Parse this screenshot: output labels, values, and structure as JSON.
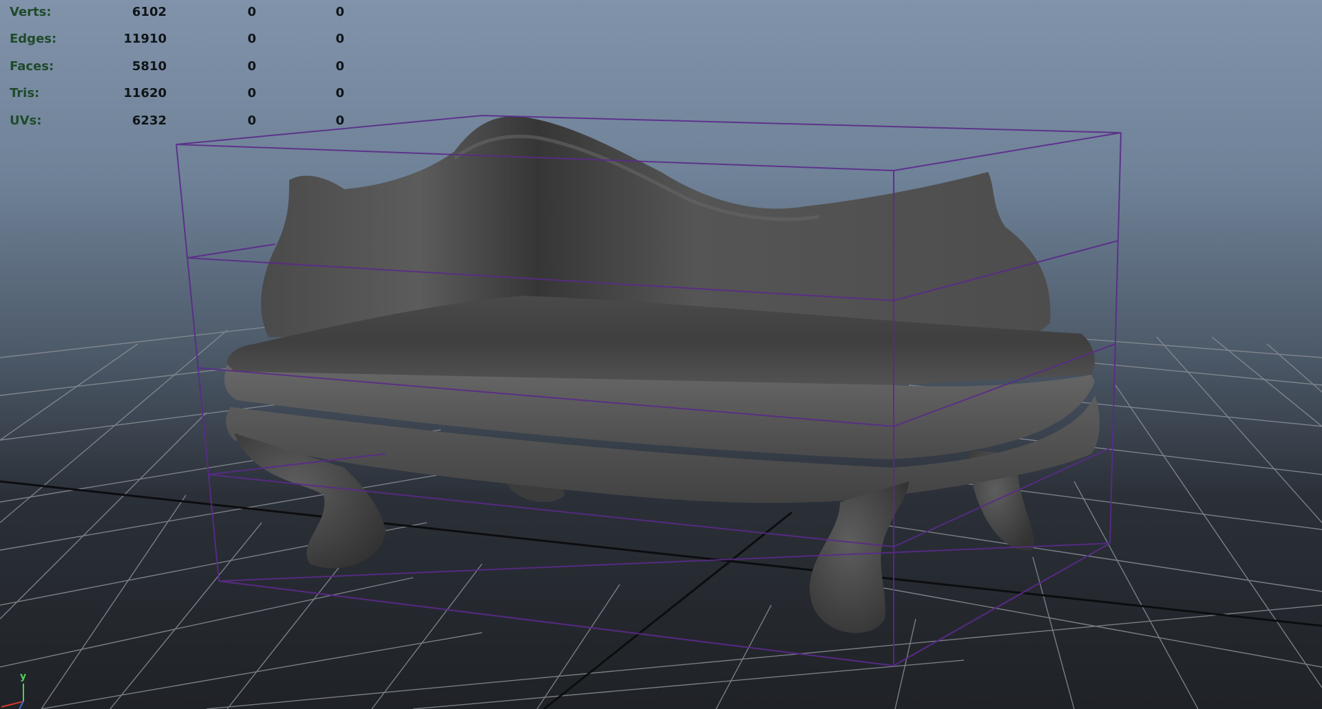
{
  "viewport": {
    "stats": [
      {
        "label": "Verts:",
        "values": [
          "6102",
          "0",
          "0"
        ]
      },
      {
        "label": "Edges:",
        "values": [
          "11910",
          "0",
          "0"
        ]
      },
      {
        "label": "Faces:",
        "values": [
          "5810",
          "0",
          "0"
        ]
      },
      {
        "label": "Tris:",
        "values": [
          "11620",
          "0",
          "0"
        ]
      },
      {
        "label": "UVs:",
        "values": [
          "6232",
          "0",
          "0"
        ]
      }
    ],
    "axis": {
      "y_label": "y"
    },
    "colors": {
      "bounding_box": "#5a2a8a",
      "grid": "#8a8f96",
      "grid_axis": "#0c0d0f",
      "model": "#5a5a5a",
      "axis_x": "#d23a2a",
      "axis_y": "#4fd15a",
      "axis_z": "#3a6ad2"
    }
  }
}
